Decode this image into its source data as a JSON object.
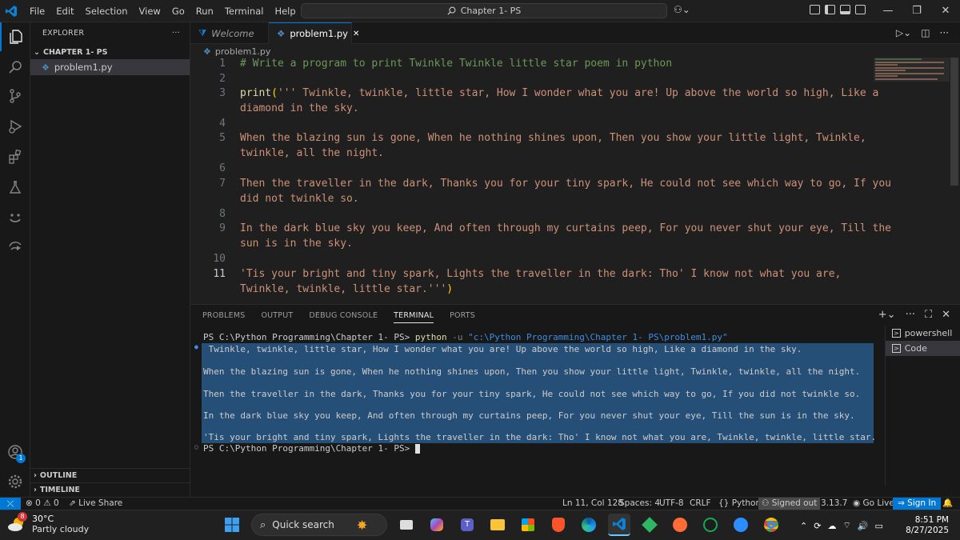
{
  "titlebar": {
    "menus": [
      "File",
      "Edit",
      "Selection",
      "View",
      "Go",
      "Run",
      "Terminal",
      "Help"
    ],
    "command_center": "Chapter 1- PS"
  },
  "sidebar": {
    "header": "EXPLORER",
    "more": "···",
    "folder": "CHAPTER 1- PS",
    "file": "problem1.py",
    "outline": "OUTLINE",
    "timeline": "TIMELINE",
    "accounts_badge": "1"
  },
  "tabs": [
    {
      "label": "Welcome"
    },
    {
      "label": "problem1.py",
      "close": "✕"
    }
  ],
  "breadcrumb": "problem1.py",
  "editor": {
    "lines": [
      {
        "n": "1",
        "text": "# Write a program to print Twinkle Twinkle little star poem in python"
      },
      {
        "n": "2",
        "text": ""
      },
      {
        "n": "3",
        "fn": "print",
        "paren": "(",
        "text": "''' Twinkle, twinkle, little star, How I wonder what you are! Up above the world so high, Like a",
        "wrap": "diamond in the sky."
      },
      {
        "n": "4",
        "text": ""
      },
      {
        "n": "5",
        "text": "When the blazing sun is gone, When he nothing shines upon, Then you show your little light, Twinkle,",
        "wrap": "twinkle, all the night."
      },
      {
        "n": "6",
        "text": ""
      },
      {
        "n": "7",
        "text": "Then the traveller in the dark, Thanks you for your tiny spark, He could not see which way to go, If you",
        "wrap": "did not twinkle so."
      },
      {
        "n": "8",
        "text": ""
      },
      {
        "n": "9",
        "text": "In the dark blue sky you keep, And often through my curtains peep, For you never shut your eye, Till the",
        "wrap": "sun is in the sky."
      },
      {
        "n": "10",
        "text": ""
      },
      {
        "n": "11",
        "text": "'Tis your bright and tiny spark, Lights the traveller in the dark: Tho' I know not what you are,",
        "wrap": "Twinkle, twinkle, little star.'''",
        "close_paren": ")"
      }
    ]
  },
  "panel": {
    "tabs": [
      "PROBLEMS",
      "OUTPUT",
      "DEBUG CONSOLE",
      "TERMINAL",
      "PORTS"
    ],
    "terminal": {
      "prompt1": "PS C:\\Python Programming\\Chapter 1- PS> ",
      "cmd": "python",
      "flag": " -u ",
      "arg": "\"c:\\Python Programming\\Chapter 1- PS\\problem1.py\"",
      "out": [
        " Twinkle, twinkle, little star, How I wonder what you are! Up above the world so high, Like a diamond in the sky.",
        "",
        "When the blazing sun is gone, When he nothing shines upon, Then you show your little light, Twinkle, twinkle, all the night.",
        "",
        "Then the traveller in the dark, Thanks you for your tiny spark, He could not see which way to go, If you did not twinkle so.",
        "",
        "In the dark blue sky you keep, And often through my curtains peep, For you never shut your eye, Till the sun is in the sky.",
        "",
        "'Tis your bright and tiny spark, Lights the traveller in the dark: Tho' I know not what you are, Twinkle, twinkle, little star. "
      ],
      "prompt2": "PS C:\\Python Programming\\Chapter 1- PS> "
    },
    "terminals": [
      "powershell",
      "Code"
    ]
  },
  "statusbar": {
    "problems": "0",
    "warnings": "0",
    "liveshare": "Live Share",
    "position": "Ln 11, Col 128",
    "spaces": "Spaces: 4",
    "encoding": "UTF-8",
    "eol": "CRLF",
    "language": "Python",
    "signed_out": "Signed out",
    "version": "3.13.7",
    "golive": "Go Live",
    "signin": "Sign In"
  },
  "taskbar": {
    "weather_badge": "8",
    "temp": "30°C",
    "condition": "Partly cloudy",
    "search": "Quick search",
    "time": "8:51 PM",
    "date": "8/27/2025"
  },
  "colors": {
    "accent": "#0078d4",
    "comment": "#6a9955",
    "string": "#ce9178",
    "function": "#dcdcaa",
    "selection": "#264f78"
  }
}
